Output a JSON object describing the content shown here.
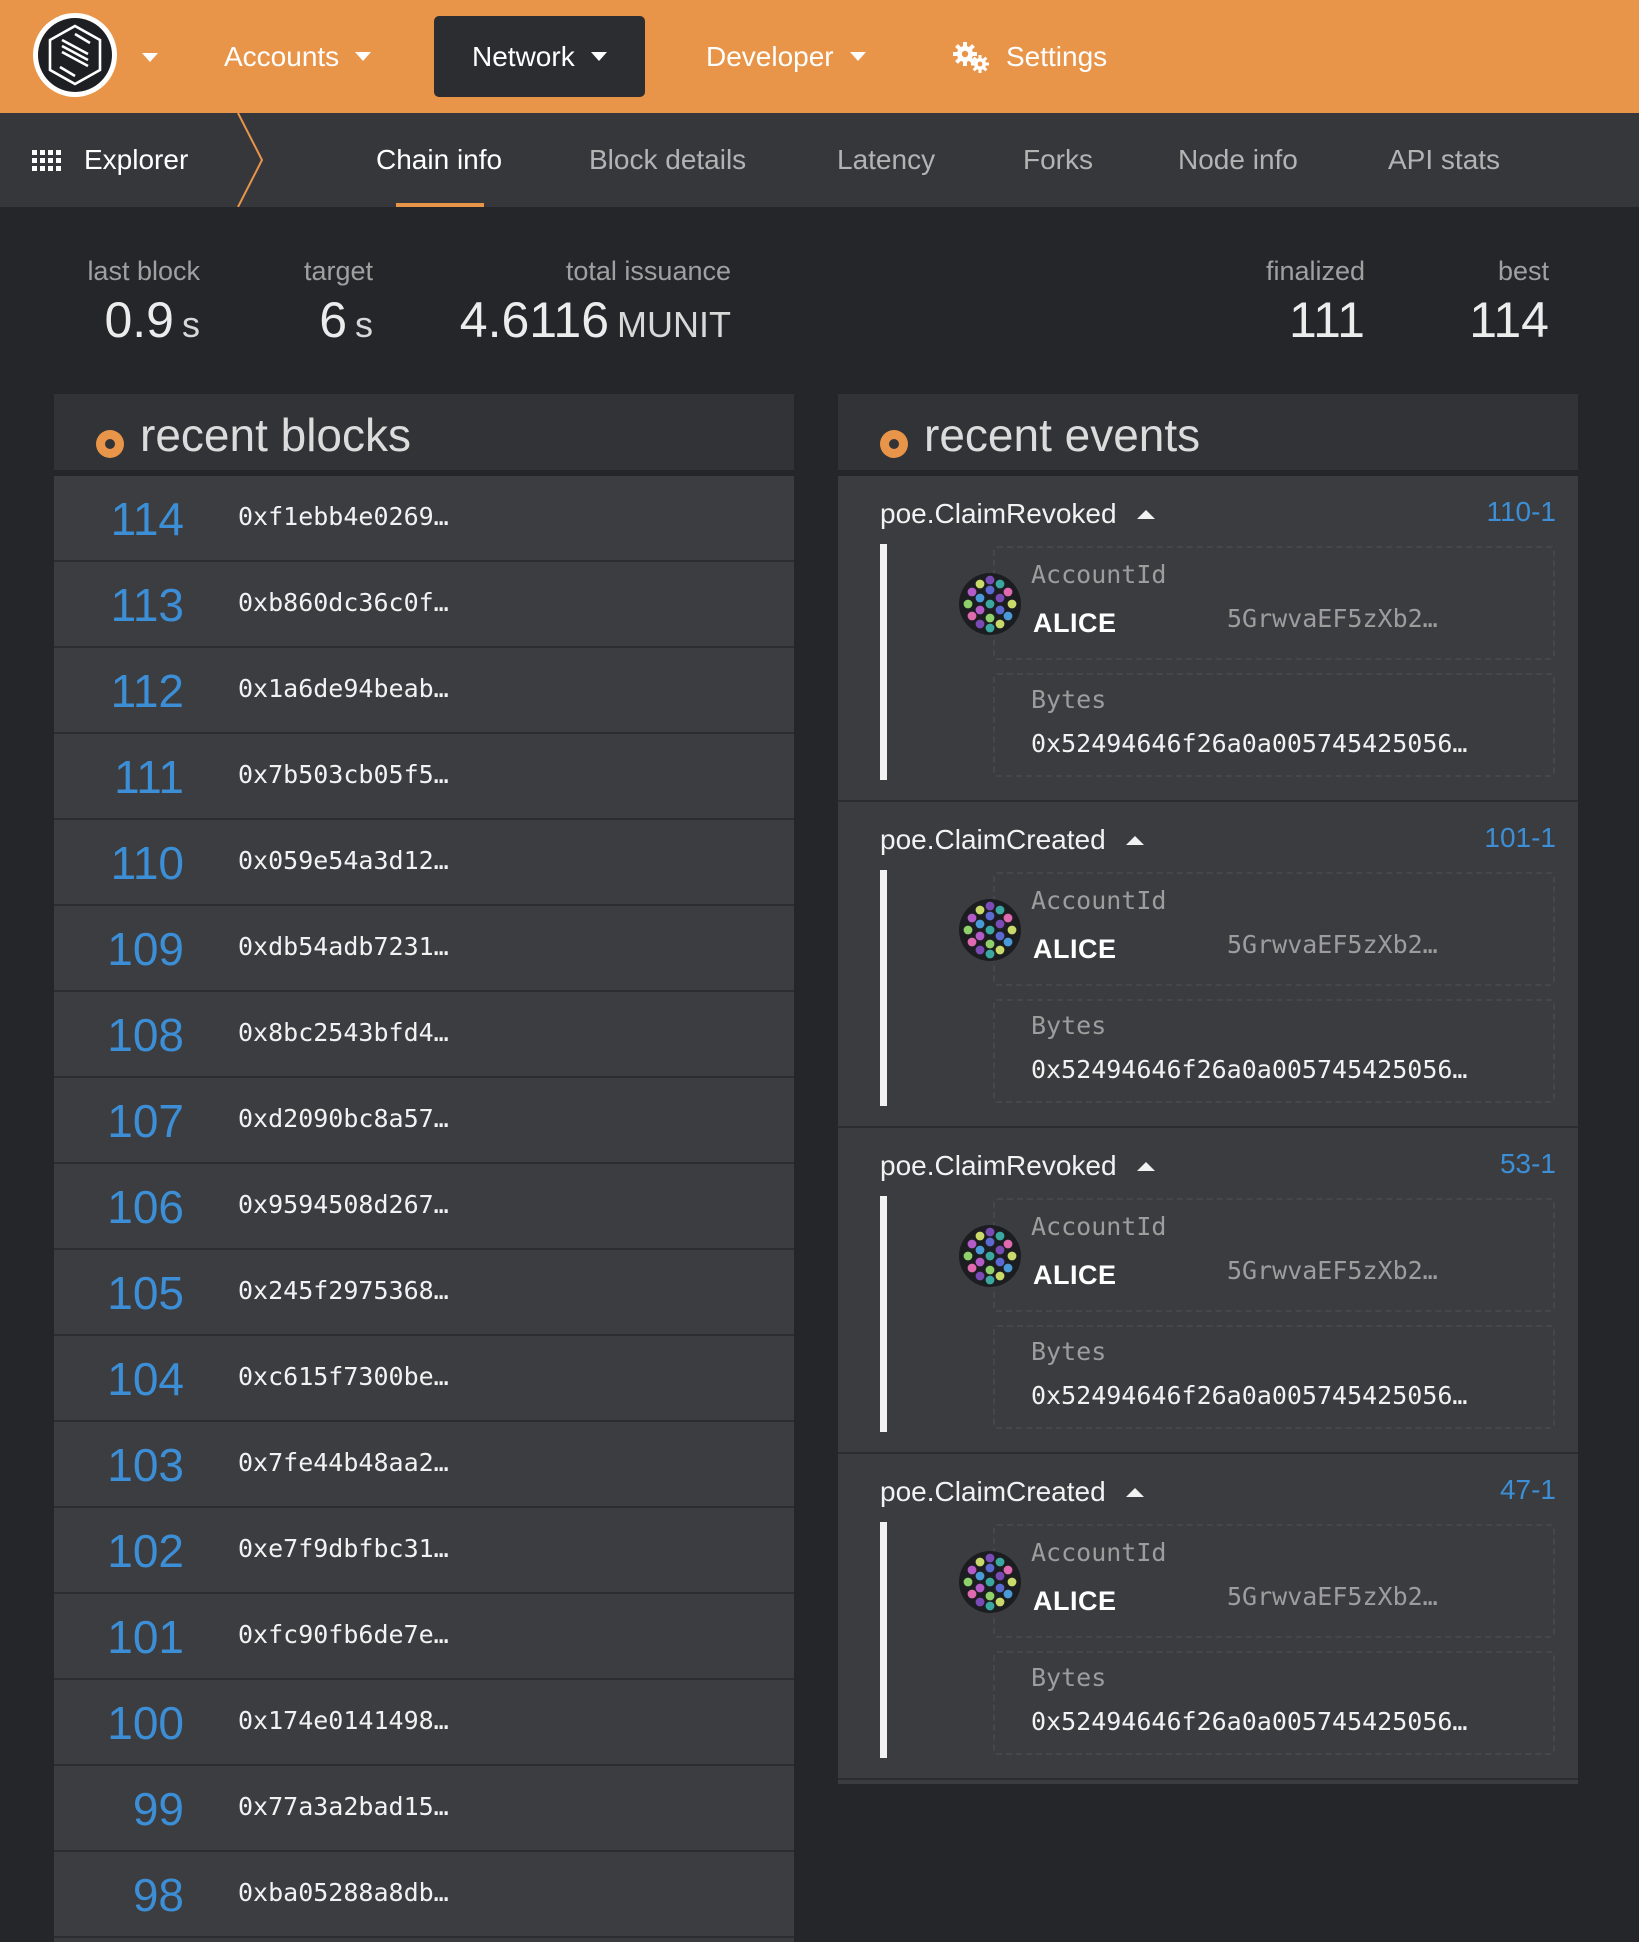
{
  "topnav": {
    "items": [
      {
        "label": "Accounts"
      },
      {
        "label": "Network"
      },
      {
        "label": "Developer"
      },
      {
        "label": "Settings"
      }
    ],
    "accent_color": "#e8954a"
  },
  "subnav": {
    "section": "Explorer",
    "tabs": [
      {
        "label": "Chain info",
        "active": true
      },
      {
        "label": "Block details"
      },
      {
        "label": "Latency"
      },
      {
        "label": "Forks"
      },
      {
        "label": "Node info"
      },
      {
        "label": "API stats"
      }
    ]
  },
  "summary": {
    "last_block": {
      "label": "last block",
      "value": "0.9",
      "unit": "s"
    },
    "target": {
      "label": "target",
      "value": "6",
      "unit": "s"
    },
    "total_issuance": {
      "label": "total issuance",
      "value": "4.6116",
      "unit": "MUNIT"
    },
    "finalized": {
      "label": "finalized",
      "value": "111"
    },
    "best": {
      "label": "best",
      "value": "114"
    }
  },
  "recent_blocks": {
    "title": "recent blocks",
    "rows": [
      {
        "number": "114",
        "hash": "0xf1ebb4e0269…"
      },
      {
        "number": "113",
        "hash": "0xb860dc36c0f…"
      },
      {
        "number": "112",
        "hash": "0x1a6de94beab…"
      },
      {
        "number": "111",
        "hash": "0x7b503cb05f5…"
      },
      {
        "number": "110",
        "hash": "0x059e54a3d12…"
      },
      {
        "number": "109",
        "hash": "0xdb54adb7231…"
      },
      {
        "number": "108",
        "hash": "0x8bc2543bfd4…"
      },
      {
        "number": "107",
        "hash": "0xd2090bc8a57…"
      },
      {
        "number": "106",
        "hash": "0x9594508d267…"
      },
      {
        "number": "105",
        "hash": "0x245f2975368…"
      },
      {
        "number": "104",
        "hash": "0xc615f7300be…"
      },
      {
        "number": "103",
        "hash": "0x7fe44b48aa2…"
      },
      {
        "number": "102",
        "hash": "0xe7f9dbfbc31…"
      },
      {
        "number": "101",
        "hash": "0xfc90fb6de7e…"
      },
      {
        "number": "100",
        "hash": "0x174e0141498…"
      },
      {
        "number": "99",
        "hash": "0x77a3a2bad15…"
      },
      {
        "number": "98",
        "hash": "0xba05288a8db…"
      }
    ]
  },
  "recent_events": {
    "title": "recent events",
    "items": [
      {
        "name": "poe.ClaimRevoked",
        "id": "110-1",
        "account_label": "AccountId",
        "account_name": "ALICE",
        "account_address": "5GrwvaEF5zXb2…",
        "bytes_label": "Bytes",
        "bytes_value": "0x52494646f26a0a005745425056…"
      },
      {
        "name": "poe.ClaimCreated",
        "id": "101-1",
        "account_label": "AccountId",
        "account_name": "ALICE",
        "account_address": "5GrwvaEF5zXb2…",
        "bytes_label": "Bytes",
        "bytes_value": "0x52494646f26a0a005745425056…"
      },
      {
        "name": "poe.ClaimRevoked",
        "id": "53-1",
        "account_label": "AccountId",
        "account_name": "ALICE",
        "account_address": "5GrwvaEF5zXb2…",
        "bytes_label": "Bytes",
        "bytes_value": "0x52494646f26a0a005745425056…"
      },
      {
        "name": "poe.ClaimCreated",
        "id": "47-1",
        "account_label": "AccountId",
        "account_name": "ALICE",
        "account_address": "5GrwvaEF5zXb2…",
        "bytes_label": "Bytes",
        "bytes_value": "0x52494646f26a0a005745425056…"
      }
    ]
  }
}
